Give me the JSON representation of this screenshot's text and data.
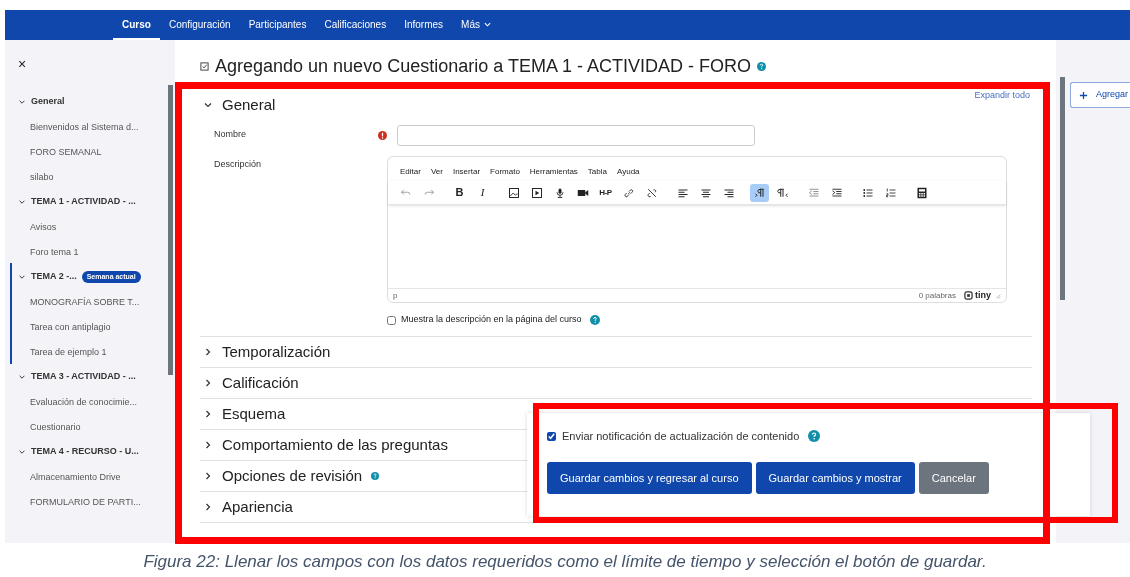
{
  "navbar": {
    "tabs": [
      {
        "label": "Curso",
        "selected": true
      },
      {
        "label": "Configuración",
        "selected": false
      },
      {
        "label": "Participantes",
        "selected": false
      },
      {
        "label": "Calificaciones",
        "selected": false
      },
      {
        "label": "Informes",
        "selected": false
      },
      {
        "label": "Más",
        "selected": false,
        "dropdown": true
      }
    ]
  },
  "sidebar": {
    "close": "×",
    "sections": [
      {
        "title": "General",
        "expanded": true,
        "children": [
          {
            "label": "Bienvenidos al Sistema d..."
          },
          {
            "label": "FORO SEMANAL"
          },
          {
            "label": "silabo"
          }
        ]
      },
      {
        "title": "TEMA 1 - ACTIVIDAD - ...",
        "expanded": true,
        "children": [
          {
            "label": "Avisos"
          },
          {
            "label": "Foro tema 1"
          }
        ]
      },
      {
        "title": "TEMA 2 -...",
        "badge": "Semana actual",
        "expanded": true,
        "current": true,
        "children": [
          {
            "label": "MONOGRAFÍA SOBRE T..."
          },
          {
            "label": "Tarea con antiplagio"
          },
          {
            "label": "Tarea de ejemplo 1"
          }
        ]
      },
      {
        "title": "TEMA 3 - ACTIVIDAD - ...",
        "expanded": true,
        "children": [
          {
            "label": "Evaluación de conocimie..."
          },
          {
            "label": "Cuestionario"
          }
        ]
      },
      {
        "title": "TEMA 4 - RECURSO - U...",
        "expanded": true,
        "children": [
          {
            "label": "Almacenamiento Drive"
          },
          {
            "label": "FORMULARIO DE PARTI..."
          }
        ]
      }
    ]
  },
  "page_title": "Agregando un nuevo Cuestionario a TEMA 1 - ACTIVIDAD - FORO",
  "expand_all": "Expandir todo",
  "general": {
    "title": "General",
    "expanded": true,
    "name_label": "Nombre",
    "description_label": "Descripción",
    "editor": {
      "menu": [
        "Editar",
        "Ver",
        "Insertar",
        "Formato",
        "Herramientas",
        "Tabla",
        "Ayuda"
      ],
      "toolbar": [
        [
          {
            "kind": "undo",
            "selected": false
          },
          {
            "kind": "redo",
            "selected": false
          }
        ],
        [
          {
            "kind": "bold",
            "label": "B",
            "selected": false
          },
          {
            "kind": "italic",
            "label": "I",
            "selected": false
          }
        ],
        [
          {
            "kind": "image",
            "selected": false
          },
          {
            "kind": "media",
            "selected": false
          },
          {
            "kind": "mic",
            "selected": false
          },
          {
            "kind": "video",
            "selected": false
          },
          {
            "kind": "h5p",
            "label": "H-P",
            "selected": false
          },
          {
            "kind": "link",
            "selected": false
          },
          {
            "kind": "unlink",
            "selected": false
          }
        ],
        [
          {
            "kind": "align-left",
            "selected": false
          },
          {
            "kind": "align-center",
            "selected": false
          },
          {
            "kind": "align-right",
            "selected": false
          }
        ],
        [
          {
            "kind": "ltr",
            "selected": true
          },
          {
            "kind": "rtl",
            "selected": false
          }
        ],
        [
          {
            "kind": "outdent",
            "selected": false
          },
          {
            "kind": "indent",
            "selected": false
          }
        ],
        [
          {
            "kind": "bullets",
            "selected": false
          },
          {
            "kind": "numbers",
            "selected": false
          }
        ],
        [
          {
            "kind": "calculator",
            "selected": false
          }
        ]
      ],
      "path": "p",
      "word_count": "0 palabras",
      "brand": "tiny"
    },
    "show_description": {
      "label": "Muestra la descripción en la página del curso",
      "checked": false
    }
  },
  "sections": [
    {
      "title": "Temporalización"
    },
    {
      "title": "Calificación"
    },
    {
      "title": "Esquema"
    },
    {
      "title": "Comportamiento de las preguntas"
    },
    {
      "title": "Opciones de revisión",
      "help": true
    },
    {
      "title": "Apariencia"
    }
  ],
  "footer": {
    "notify": {
      "label": "Enviar notificación de actualización de contenido",
      "checked": true
    },
    "buttons": [
      {
        "label": "Guardar cambios y regresar al curso",
        "kind": "primary"
      },
      {
        "label": "Guardar cambios y mostrar",
        "kind": "primary"
      },
      {
        "label": "Cancelar",
        "kind": "secondary"
      }
    ]
  },
  "drawer": {
    "add_button": "Agregar"
  },
  "caption": "Figura 22: Llenar los campos con los datos requeridos como el límite de tiempo y selección el botón de guardar."
}
